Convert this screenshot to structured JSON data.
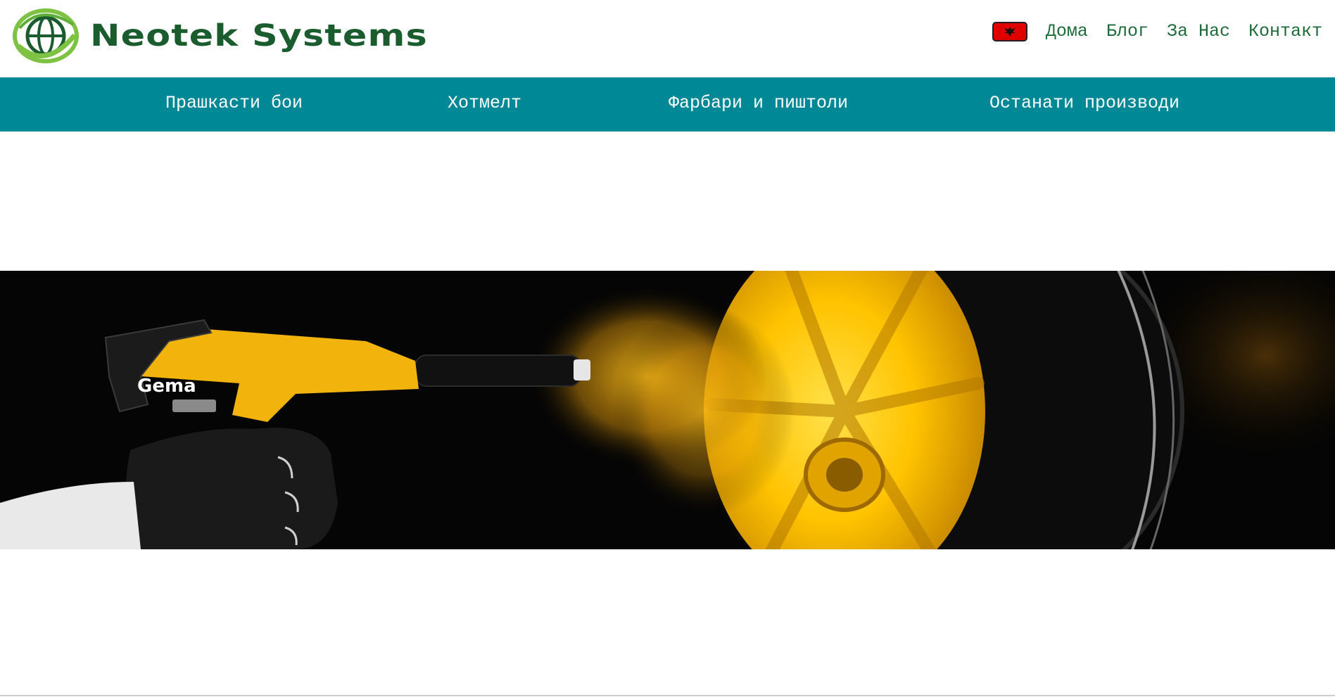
{
  "brand": {
    "name": "Neotek Systems"
  },
  "top_nav": {
    "flag_icon": "albanian-flag-icon",
    "links": [
      "Дома",
      "Блог",
      "За Нас",
      "Контакт"
    ]
  },
  "categories": [
    "Прашкасти бои",
    "Хотмелт",
    "Фарбари и пиштоли",
    "Останати производи"
  ],
  "banner": {
    "gun_brand": "Gema"
  },
  "colors": {
    "accent": "#008896",
    "brand_green": "#1a5c2e",
    "link_green": "#1d6b3a",
    "flag_red": "#e00000"
  }
}
